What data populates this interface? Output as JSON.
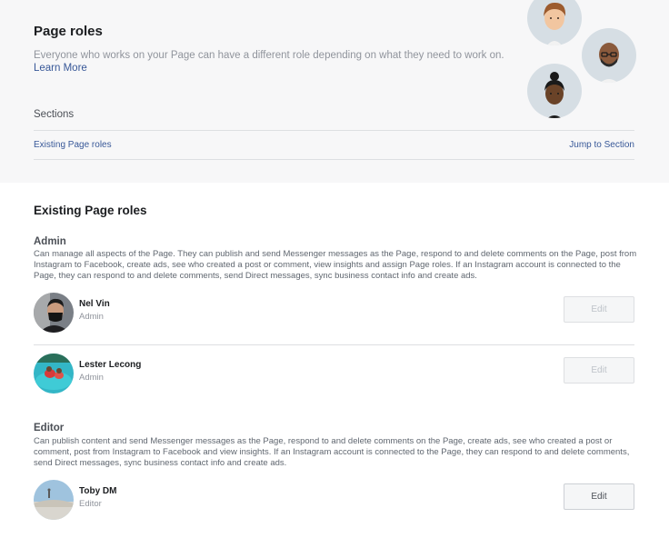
{
  "header": {
    "title": "Page roles",
    "description": "Everyone who works on your Page can have a different role depending on what they need to work on.",
    "learn_more": "Learn More",
    "sections_label": "Sections",
    "sections": [
      {
        "label": "Existing Page roles",
        "action": "Jump to Section"
      }
    ]
  },
  "existing": {
    "title": "Existing Page roles",
    "roles": [
      {
        "name": "Admin",
        "description": "Can manage all aspects of the Page. They can publish and send Messenger messages as the Page, respond to and delete comments on the Page, post from Instagram to Facebook, create ads, see who created a post or comment, view insights and assign Page roles. If an Instagram account is connected to the Page, they can respond to and delete comments, send Direct messages, sync business contact info and create ads.",
        "people": [
          {
            "name": "Nel Vin",
            "role": "Admin",
            "edit": "Edit",
            "edit_enabled": false
          },
          {
            "name": "Lester Lecong",
            "role": "Admin",
            "edit": "Edit",
            "edit_enabled": false
          }
        ]
      },
      {
        "name": "Editor",
        "description": "Can publish content and send Messenger messages as the Page, respond to and delete comments on the Page, create ads, see who created a post or comment, post from Instagram to Facebook and view insights. If an Instagram account is connected to the Page, they can respond to and delete comments, send Direct messages, sync business contact info and create ads.",
        "people": [
          {
            "name": "Toby DM",
            "role": "Editor",
            "edit": "Edit",
            "edit_enabled": true
          }
        ]
      }
    ]
  },
  "colors": {
    "link": "#385898",
    "header_bg": "#f7f7f8",
    "divider": "#dddfe2"
  }
}
